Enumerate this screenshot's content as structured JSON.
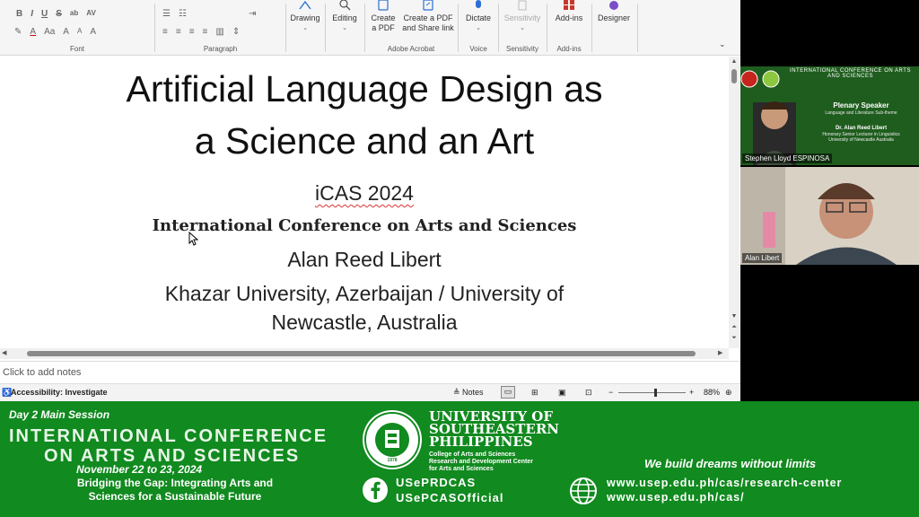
{
  "ribbon": {
    "groups": {
      "font": "Font",
      "paragraph": "Paragraph",
      "acrobat": "Adobe Acrobat",
      "voice": "Voice",
      "sensitivity": "Sensitivity",
      "addins": "Add-ins"
    },
    "buttons": {
      "drawing": "Drawing",
      "editing": "Editing",
      "create_pdf_1": "Create",
      "create_pdf_2": "a PDF",
      "share_pdf_1": "Create a PDF",
      "share_pdf_2": "and Share link",
      "dictate": "Dictate",
      "sensitivity": "Sensitivity",
      "addins": "Add-ins",
      "designer": "Designer"
    },
    "font_glyphs": [
      "B",
      "I",
      "U",
      "S",
      "ab",
      "AV"
    ],
    "font_glyphs2": [
      "A",
      "A",
      "Aa",
      "A",
      "A",
      "A"
    ]
  },
  "slide": {
    "title_line1": "Artificial Language Design as",
    "title_line2": "a Science and an Art",
    "event_short": "iCAS 2024",
    "event_full": "International Conference on Arts and Sciences",
    "author": "Alan Reed Libert",
    "affiliation_line1": "Khazar University, Azerbaijan / University of",
    "affiliation_line2": "Newcastle, Australia"
  },
  "notes_placeholder": "Click to add notes",
  "status": {
    "accessibility": "Accessibility: Investigate",
    "notes": "Notes",
    "zoom": "88%",
    "zoom_fraction": 0.55
  },
  "video": {
    "tile1": {
      "name": "Stephen Lloyd ESPINOSA",
      "header": "INTERNATIONAL CONFERENCE ON ARTS AND SCIENCES",
      "role": "Plenary Speaker",
      "subtitle": "Language and Literature Sub-theme",
      "speaker": "Dr. Alan Reed Libert",
      "speaker_title1": "Honorary Senior Lecturer in Linguistics",
      "speaker_title2": "University of Newcastle Australia"
    },
    "tile2": {
      "name": "Alan Libert"
    }
  },
  "banner": {
    "session": "Day 2 Main Session",
    "conf_line1": "INTERNATIONAL CONFERENCE",
    "conf_line2": "ON ARTS AND SCIENCES",
    "dates": "November 22 to 23, 2024",
    "theme_line1": "Bridging the Gap: Integrating Arts and",
    "theme_line2": "Sciences for a Sustainable Future",
    "univ_line1": "UNIVERSITY OF",
    "univ_line2": "SOUTHEASTERN",
    "univ_line3": "PHILIPPINES",
    "college_line1": "College of Arts and Sciences",
    "college_line2": "Research and Development Center",
    "college_line3": "for Arts and Sciences",
    "social1": "USePRDCAS",
    "social2": "USePCASOfficial",
    "tagline": "We build dreams without limits",
    "url1": "www.usep.edu.ph/cas/research-center",
    "url2": "www.usep.edu.ph/cas/",
    "seal_year": "1978"
  },
  "colors": {
    "banner_green": "#118a1f",
    "acrobat_blue": "#2b6fd6",
    "addins_red": "#c8372d",
    "designer_purple": "#7a4cc9"
  }
}
